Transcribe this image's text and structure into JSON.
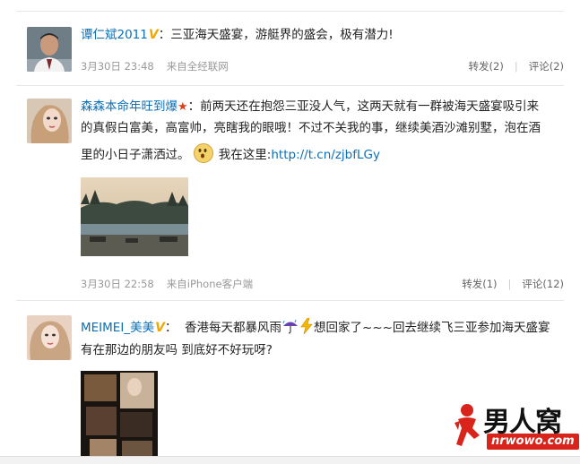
{
  "posts": [
    {
      "author": "谭仁斌2011",
      "colon": "：",
      "text": "三亚海天盛宴，游艇界的盛会，极有潜力!",
      "time": "3月30日 23:48",
      "source": "来自全经联网",
      "repost": "转发(2)",
      "comment": "评论(2)"
    },
    {
      "author": "森森本命年旺到爆",
      "colon": "：",
      "text_line1": "前两天还在抱怨三亚没人气，这两天就有一群被海天盛宴吸引来",
      "text_line2": "的真假白富美，高富帅，亮瞎我的眼哦！不过不关我的事，继续美酒沙滩别墅，泡在酒",
      "text_line3a": "里的小日子潇洒过。",
      "text_line3b": "我在这里:",
      "link": "http://t.cn/zjbfLGy",
      "time": "3月30日 22:58",
      "source": "来自iPhone客户端",
      "repost": "转发(1)",
      "comment": "评论(12)"
    },
    {
      "author": "MEIMEI_美美",
      "colon": "：",
      "text_line1a": "香港每天都暴风雨",
      "text_line1b": "想回家了~~~回去继续飞三亚参加海天盛宴",
      "text_line2": "有在那边的朋友吗 到底好不好玩呀?"
    }
  ],
  "separator": "|",
  "watermark": {
    "brand": "男人窝",
    "url": "nrwowo.com"
  },
  "colors": {
    "link": "#0a6fb5",
    "badge": "#f0a800",
    "logo_red": "#d9241c"
  }
}
